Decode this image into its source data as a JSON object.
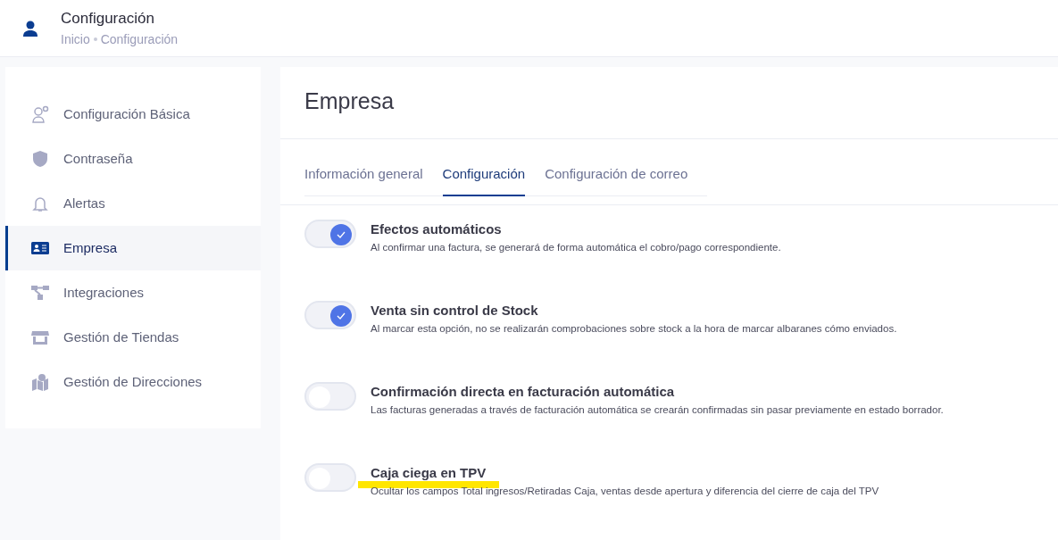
{
  "header": {
    "title": "Configuración",
    "breadcrumb": [
      "Inicio",
      "Configuración"
    ]
  },
  "sidebar": {
    "items": [
      {
        "label": "Configuración Básica",
        "selected": false
      },
      {
        "label": "Contraseña",
        "selected": false
      },
      {
        "label": "Alertas",
        "selected": false
      },
      {
        "label": "Empresa",
        "selected": true
      },
      {
        "label": "Integraciones",
        "selected": false
      },
      {
        "label": "Gestión de Tiendas",
        "selected": false
      },
      {
        "label": "Gestión de Direcciones",
        "selected": false
      }
    ]
  },
  "panel": {
    "title": "Empresa",
    "tabs": [
      {
        "label": "Información general",
        "selected": false
      },
      {
        "label": "Configuración",
        "selected": true
      },
      {
        "label": "Configuración de correo",
        "selected": false
      }
    ],
    "settings": [
      {
        "title": "Efectos automáticos",
        "description": "Al confirmar una factura, se generará de forma automática el cobro/pago correspondiente.",
        "on": true,
        "highlighted": false
      },
      {
        "title": "Venta sin control de Stock",
        "description": "Al marcar esta opción, no se realizarán comprobaciones sobre stock a la hora de marcar albaranes cómo enviados.",
        "on": true,
        "highlighted": false
      },
      {
        "title": "Confirmación directa en facturación automática",
        "description": "Las facturas generadas a través de facturación automática se crearán confirmadas sin pasar previamente en estado borrador.",
        "on": false,
        "highlighted": false
      },
      {
        "title": "Caja ciega en TPV",
        "description": "Ocultar los campos Total ingresos/Retiradas Caja, ventas desde apertura y diferencia del cierre de caja del TPV",
        "on": false,
        "highlighted": true
      }
    ]
  }
}
